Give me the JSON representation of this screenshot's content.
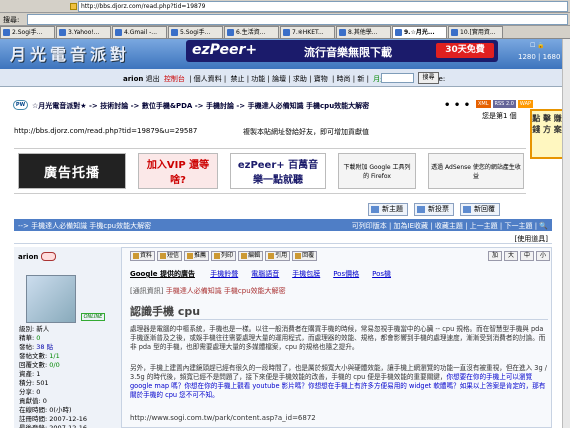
{
  "browser": {
    "address": "http://bbs.djorz.com/read.php?tid=19879",
    "search_label": "搜尋:",
    "tabs": [
      {
        "label": "2.Sogi手...",
        "active": false
      },
      {
        "label": "3.Yahoo!...",
        "active": false
      },
      {
        "label": "4.Gmail -...",
        "active": false
      },
      {
        "label": "5.Sogi手...",
        "active": false
      },
      {
        "label": "6.生活資...",
        "active": false
      },
      {
        "label": "7.※HKET...",
        "active": false
      },
      {
        "label": "8.其他學...",
        "active": false
      },
      {
        "label": "9.☆月光...",
        "active": true
      },
      {
        "label": "10.[實用資...",
        "active": false
      }
    ]
  },
  "header": {
    "logo": "月光電音派對",
    "banner_brand": "ezPeer+",
    "banner_slogan": "流行音樂無限下載",
    "banner_badge": "30天免費",
    "stat_icons": "☐ 🔒",
    "resolution": "1280 | 1680"
  },
  "menubar": {
    "user": "arion",
    "items": [
      "退出",
      "| 個人資料 |",
      "禁止 | 功能 | 論壇 | 求助 | 寶物",
      "| 時尚 | 新 |"
    ],
    "red_item": "控制台",
    "green_item": "月光帳號 vip",
    "google_label": "Google:",
    "search_button": "搜尋"
  },
  "breadcrumb": {
    "badge": "PW",
    "text": "☆月光電音派對★ -> 技術討論 -> 數位手機&PDA -> 手機討論 -> 手機達人必備知識   手機cpu效能大解密",
    "dots": "• • •",
    "rss": [
      {
        "label": "XML",
        "color": "#e66000"
      },
      {
        "label": "RSS 2.0",
        "color": "#669"
      },
      {
        "label": "WAP",
        "color": "#f90"
      }
    ],
    "note": "您是第1 個",
    "side_ad": "點 擊 賺 錢 方 案"
  },
  "url_row": {
    "url": "http://bbs.djorz.com/read.php?tid=19879&u=29587",
    "hint": "複製本貼網址發給好友，即可增加貢獻值"
  },
  "ads": {
    "ad1": "廣告托播",
    "ad2": "加入VIP 還等啥?",
    "ad3": "ezPeer+ 百萬音樂一點就聽",
    "ad4": "下載附加 Google 工具列的 Firefox",
    "ad5": "透過 AdSense 使您的網站產生收益"
  },
  "actions": [
    "新主題",
    "新投票",
    "新回覆"
  ],
  "thread": {
    "title": "--> 手機達人必備知識   手機cpu效能大解密",
    "links": "可列印版本 | 加為IE收藏 | 收藏主題 | 上一主題 | 下一主題 | 🔍",
    "tools": "[使用道具]"
  },
  "author": {
    "name": "arion",
    "online": "ONLINE",
    "stats": [
      {
        "label": "級別:",
        "value": "新人",
        "cls": ""
      },
      {
        "label": "精華:",
        "value": "0",
        "cls": "v"
      },
      {
        "label": "發帖:",
        "value": "38 貼",
        "cls": "vb"
      },
      {
        "label": "發帖文數:",
        "value": "1/1",
        "cls": "v"
      },
      {
        "label": "回覆文數:",
        "value": "0/0",
        "cls": "v"
      },
      {
        "label": "資產:",
        "value": "1",
        "cls": ""
      },
      {
        "label": "積分:",
        "value": "501",
        "cls": ""
      },
      {
        "label": "分享:",
        "value": "0",
        "cls": ""
      },
      {
        "label": "貢獻值:",
        "value": "0",
        "cls": ""
      },
      {
        "label": "在線時間:",
        "value": "0(小時)",
        "cls": ""
      },
      {
        "label": "註冊時間:",
        "value": "2007-12-16",
        "cls": ""
      },
      {
        "label": "最後登錄:",
        "value": "2007-12-16",
        "cls": ""
      }
    ]
  },
  "post": {
    "toolbar": [
      "資料",
      "短信",
      "推薦",
      "列印",
      "編輯",
      "引用",
      "回覆"
    ],
    "sizes": [
      "加",
      "大",
      "中",
      "小"
    ],
    "ad_links_label": "Google 提供的廣告",
    "ad_links": [
      "手機鈴聲",
      "電腦語音",
      "手機包膜",
      "Pos價格",
      "Pos機"
    ],
    "tag_category": "[通訊資訊]",
    "tag_desc": "手機達人必備知識   手機cpu效能大解密",
    "title": "認識手機 cpu",
    "para1": "處理器是電腦的中樞系統，手機也是一樣。以往一般消費者在購買手機的時候，常易忽視手機當中的心臟 -- cpu 規格。而在智慧型手機與 pda 手機逐漸普及之後，或娛手機往往需要處理大量的運用程式，而處理器的效能、規格，都會影響到手機的處理速度，漸漸受到消費者的討論。而非 pda 型的手機，也即需要處理大量的多媒體檔案，cpu 的規格也隨之提升。",
    "para2_start": "另外，手機上建置內建鏡頭趕已經有很久的一段時間了，也是厲於頻寬大小與硬體效能，讓手機上網瀏覽的功能一直沒有被重視，但在進入 3g / 3.5g 的時代後，頻寬已經不是問題了，接下來便是手機效能的改善，手機的 cpu 便是手機效能的重要關鍵，",
    "para2_link": "你想要在你的手機上可以瀏覽 google map 嗎？你想在你的手機上觀看 youtube 影片嗎？你想想在手機上有許多方便易用的 widget 軟體嗎？如果以上答案是肯定的，那有關於手機的 cpu 您不可不知。",
    "url_line": "http://www.sogi.com.tw/park/content.asp?a_id=6872"
  }
}
